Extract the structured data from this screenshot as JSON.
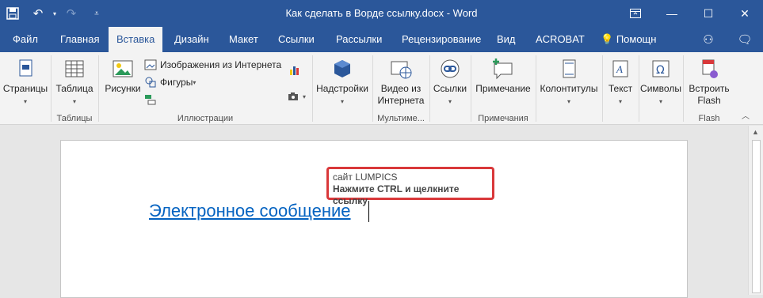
{
  "titlebar": {
    "title": "Как сделать в Ворде ссылку.docx - Word",
    "qat": {
      "save_icon": "save-icon",
      "undo_icon": "undo-icon",
      "redo_icon": "redo-icon",
      "customize_icon": "customize-qat-icon"
    },
    "controls": {
      "ribbon_options": "ribbon-display-options-icon",
      "minimize": "minimize-icon",
      "maximize": "maximize-icon",
      "close": "close-icon"
    }
  },
  "tabs": [
    {
      "label": "Файл"
    },
    {
      "label": "Главная"
    },
    {
      "label": "Вставка"
    },
    {
      "label": "Дизайн"
    },
    {
      "label": "Макет"
    },
    {
      "label": "Ссылки"
    },
    {
      "label": "Рассылки"
    },
    {
      "label": "Рецензирование"
    },
    {
      "label": "Вид"
    },
    {
      "label": "ACROBAT"
    },
    {
      "label": "Помощн"
    }
  ],
  "active_tab": "Вставка",
  "ribbon": {
    "pages": {
      "label": "Страницы"
    },
    "table": {
      "label": "Таблица",
      "group": "Таблицы"
    },
    "illustrations": {
      "group": "Иллюстрации",
      "pictures": "Рисунки",
      "online_pictures": "Изображения из Интернета",
      "shapes": "Фигуры"
    },
    "addins": {
      "label": "Надстройки"
    },
    "media": {
      "label1": "Видео из",
      "label2": "Интернета",
      "group": "Мультиме..."
    },
    "links": {
      "label": "Ссылки"
    },
    "comments": {
      "label": "Примечание",
      "group": "Примечания"
    },
    "header_footer": {
      "label": "Колонтитулы"
    },
    "text": {
      "label": "Текст"
    },
    "symbols": {
      "label": "Символы"
    },
    "flash": {
      "label1": "Встроить",
      "label2": "Flash",
      "group": "Flash"
    }
  },
  "document": {
    "link_text": "Электронное сообщение",
    "tooltip": {
      "line1": "сайт LUMPICS",
      "line2": "Нажмите CTRL и щелкните ссылку"
    }
  },
  "colors": {
    "accent": "#2b579a",
    "link": "#0563c1",
    "highlight_border": "#d9383a"
  }
}
